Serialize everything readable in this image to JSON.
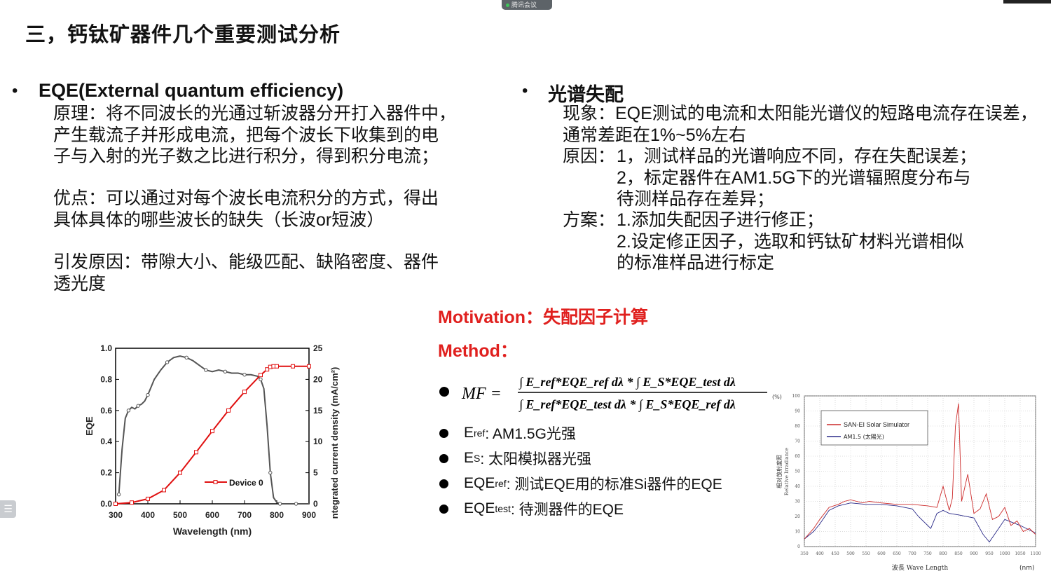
{
  "meeting": {
    "app_label": "腾讯会议"
  },
  "slide": {
    "title": "三，钙钛矿器件几个重要测试分析",
    "left": {
      "bullet": "•",
      "heading": "EQE(External quantum efficiency)",
      "principle": [
        "原理：将不同波长的光通过斩波器分开打入器件中，",
        "产生载流子并形成电流，把每个波长下收集到的电",
        "子与入射的光子数之比进行积分，得到积分电流；"
      ],
      "advantage": [
        "优点：可以通过对每个波长电流积分的方式，得出",
        "具体具体的哪些波长的缺失（长波or短波）"
      ],
      "cause": [
        "引发原因：带隙大小、能级匹配、缺陷密度、器件",
        "透光度"
      ]
    },
    "right": {
      "bullet": "•",
      "heading": "光谱失配",
      "phenomenon": [
        "现象：EQE测试的电流和太阳能光谱仪的短路电流存在误差，",
        "通常差距在1%~5%左右"
      ],
      "reason_label": "原因：",
      "reason_lines": [
        "1，测试样品的光谱响应不同，存在失配误差；",
        "2，标定器件在AM1.5G下的光谱辐照度分布与",
        "待测样品存在差异；"
      ],
      "plan_label": "方案：",
      "plan_lines": [
        "1.添加失配因子进行修正；",
        "2.设定修正因子，选取和钙钛矿材料光谱相似",
        "的标准样品进行标定"
      ]
    },
    "motivation": "Motivation：失配因子计算",
    "method": "Method：",
    "formula": {
      "lhs": "MF =",
      "numerator": "∫ E_ref*EQE_ref dλ * ∫ E_S*EQE_test dλ",
      "denominator": "∫ E_ref*EQE_test dλ * ∫ E_S*EQE_ref dλ"
    },
    "definitions": [
      {
        "sym": "E",
        "sub": "ref",
        "text": ": AM1.5G光强"
      },
      {
        "sym": "E",
        "sub": "S",
        "text": ":  太阳模拟器光强"
      },
      {
        "sym": "EQE",
        "sub": "ref",
        "text": ": 测试EQE用的标准Si器件的EQE"
      },
      {
        "sym": "EQE",
        "sub": "test",
        "text": ": 待测器件的EQE"
      }
    ]
  },
  "chart_data": [
    {
      "type": "line",
      "title": "",
      "xlabel": "Wavelength (nm)",
      "ylabel": "EQE",
      "y2label": "ntegrated current density (mA/cm²)",
      "xlim": [
        300,
        900
      ],
      "ylim": [
        0,
        1.0
      ],
      "y2lim": [
        0,
        25
      ],
      "x_ticks": [
        "300",
        "400",
        "500",
        "600",
        "700",
        "800",
        "900"
      ],
      "y_ticks": [
        "0.0",
        "0.2",
        "0.4",
        "0.6",
        "0.8",
        "1.0"
      ],
      "y2_ticks": [
        "0",
        "5",
        "10",
        "15",
        "20",
        "25"
      ],
      "legend": "Device 0",
      "colors": {
        "eqe": "#555555",
        "jsc": "#e01010"
      },
      "series": [
        {
          "name": "",
          "axis": "left",
          "x": [
            310,
            320,
            330,
            340,
            350,
            360,
            370,
            380,
            390,
            400,
            420,
            440,
            460,
            480,
            500,
            520,
            540,
            560,
            580,
            600,
            620,
            640,
            660,
            680,
            700,
            720,
            740,
            750,
            760,
            770,
            780,
            790,
            800,
            810,
            820,
            840,
            860,
            880,
            900
          ],
          "y": [
            0.06,
            0.35,
            0.55,
            0.6,
            0.62,
            0.61,
            0.63,
            0.64,
            0.66,
            0.7,
            0.8,
            0.86,
            0.91,
            0.94,
            0.95,
            0.94,
            0.92,
            0.89,
            0.86,
            0.85,
            0.86,
            0.85,
            0.84,
            0.84,
            0.83,
            0.83,
            0.82,
            0.8,
            0.74,
            0.5,
            0.2,
            0.04,
            0.01,
            0.0,
            0.0,
            0.0,
            0.0,
            0.0,
            0.0
          ]
        },
        {
          "name": "Device 0",
          "axis": "right",
          "x": [
            300,
            350,
            400,
            450,
            500,
            550,
            600,
            650,
            700,
            750,
            770,
            780,
            790,
            800,
            850,
            900
          ],
          "y": [
            0.0,
            0.2,
            0.8,
            2.2,
            5.0,
            8.3,
            11.7,
            15.0,
            18.0,
            20.7,
            21.6,
            22.0,
            22.1,
            22.1,
            22.1,
            22.1
          ]
        }
      ]
    },
    {
      "type": "line",
      "title": "",
      "xlabel": "波長 Wave Length",
      "x_unit": "(nm)",
      "ylabel": "相对放射度照",
      "ylabel2": "Relative Irradiance",
      "y_unit": "(%)",
      "xlim": [
        350,
        1100
      ],
      "ylim": [
        0,
        100
      ],
      "x_ticks": [
        "350",
        "400",
        "450",
        "500",
        "550",
        "600",
        "650",
        "700",
        "750",
        "800",
        "850",
        "900",
        "950",
        "1000",
        "1050",
        "1100"
      ],
      "y_ticks": [
        "0",
        "10",
        "20",
        "30",
        "40",
        "50",
        "60",
        "70",
        "80",
        "90",
        "100"
      ],
      "legend": [
        "SAN-EI Solar Simulator",
        "AM1.5 (太陽光)"
      ],
      "colors": {
        "sim": "#cc2a2a",
        "am15": "#2a2a88"
      },
      "series": [
        {
          "name": "SAN-EI Solar Simulator",
          "x": [
            350,
            380,
            400,
            430,
            460,
            480,
            500,
            520,
            540,
            560,
            600,
            650,
            700,
            750,
            780,
            800,
            820,
            830,
            840,
            850,
            860,
            880,
            900,
            920,
            940,
            960,
            980,
            1000,
            1020,
            1040,
            1060,
            1080,
            1100
          ],
          "y": [
            5,
            12,
            18,
            26,
            28,
            30,
            31,
            30,
            29,
            30,
            29,
            28,
            28,
            27,
            26,
            40,
            24,
            32,
            80,
            95,
            30,
            48,
            22,
            25,
            35,
            18,
            20,
            26,
            14,
            17,
            10,
            12,
            8
          ]
        },
        {
          "name": "AM1.5 (太陽光)",
          "x": [
            350,
            380,
            400,
            430,
            460,
            480,
            500,
            550,
            600,
            650,
            700,
            720,
            760,
            780,
            800,
            820,
            850,
            900,
            930,
            950,
            980,
            1000,
            1050,
            1100
          ],
          "y": [
            5,
            10,
            15,
            24,
            27,
            28,
            29,
            28,
            28,
            27,
            25,
            20,
            12,
            22,
            24,
            22,
            21,
            19,
            8,
            3,
            12,
            18,
            14,
            9
          ]
        }
      ]
    }
  ]
}
